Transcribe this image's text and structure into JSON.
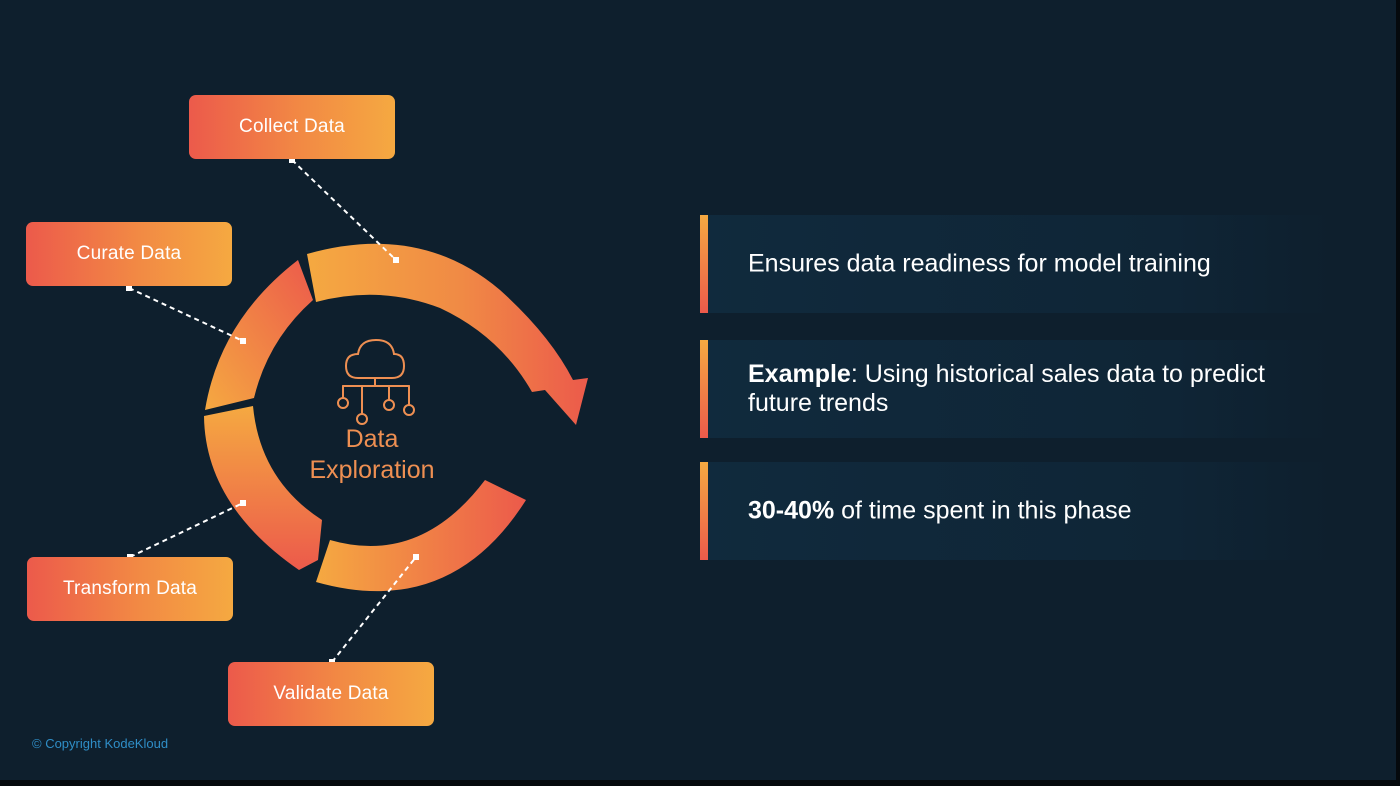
{
  "diagram": {
    "center_label_line1": "Data",
    "center_label_line2": "Exploration",
    "center_icon": "cloud-network-icon",
    "steps": [
      {
        "label": "Collect Data"
      },
      {
        "label": "Curate Data"
      },
      {
        "label": "Transform Data"
      },
      {
        "label": "Validate Data"
      }
    ],
    "colors": {
      "accent_red": "#ec5a4b",
      "accent_orange": "#f5a941",
      "background": "#0e1f2d"
    }
  },
  "points": [
    {
      "bold": "",
      "text": "Ensures data readiness for model training"
    },
    {
      "bold": "Example",
      "text": ": Using historical sales data to predict future trends"
    },
    {
      "bold": "30-40%",
      "text": " of time spent in this phase"
    }
  ],
  "footer": {
    "copyright": "© Copyright KodeKloud"
  }
}
